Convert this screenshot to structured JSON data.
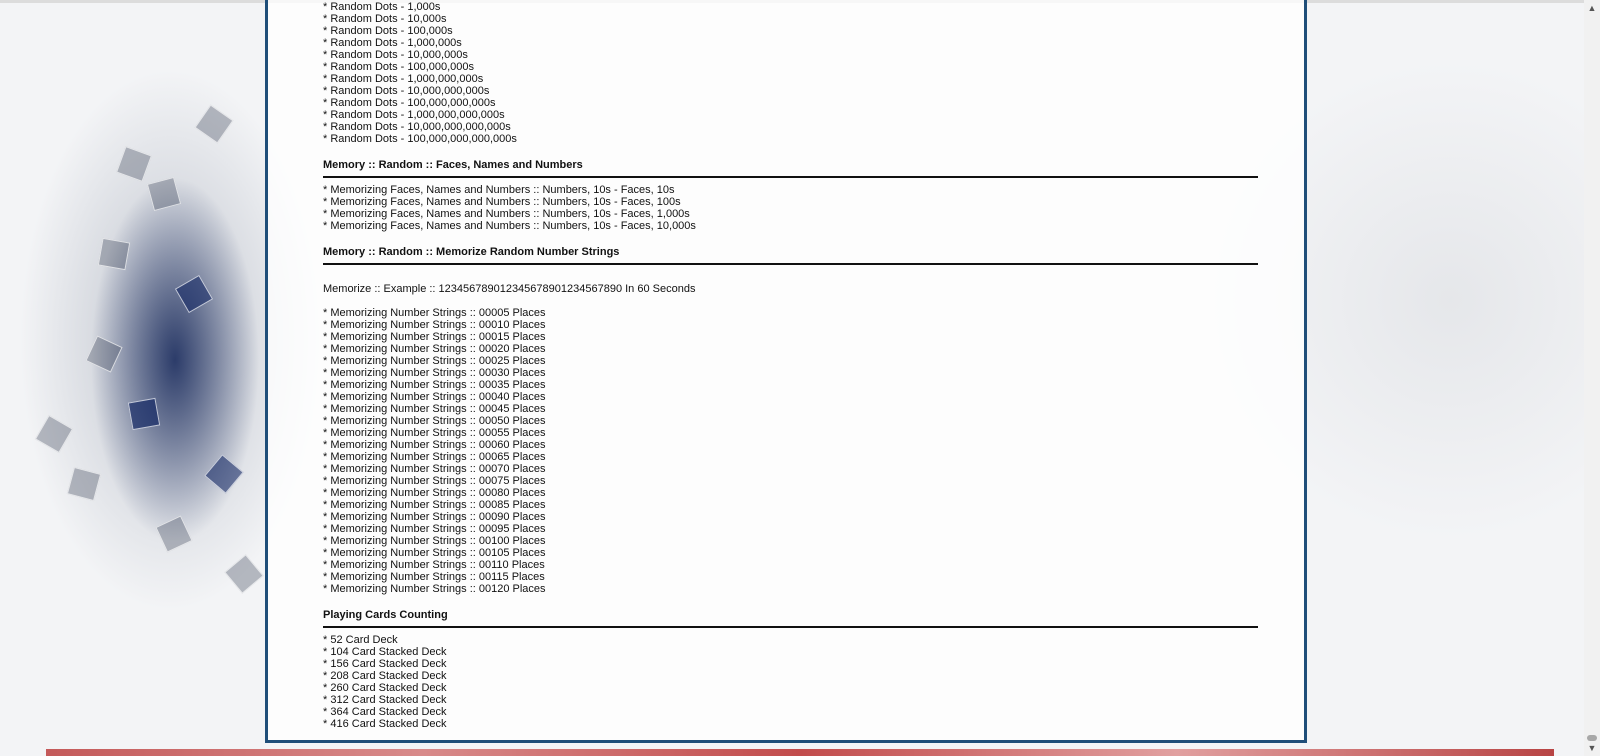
{
  "dots_list": [
    "* Random Dots - 1,000s",
    "* Random Dots - 10,000s",
    "* Random Dots - 100,000s",
    "* Random Dots - 1,000,000s",
    "* Random Dots - 10,000,000s",
    "* Random Dots - 100,000,000s",
    "* Random Dots - 1,000,000,000s",
    "* Random Dots - 10,000,000,000s",
    "* Random Dots - 100,000,000,000s",
    "* Random Dots - 1,000,000,000,000s",
    "* Random Dots - 10,000,000,000,000s",
    "* Random Dots - 100,000,000,000,000s"
  ],
  "faces_section": {
    "heading": "Memory :: Random :: Faces, Names and Numbers",
    "items": [
      "* Memorizing Faces, Names and Numbers :: Numbers, 10s - Faces, 10s",
      "* Memorizing Faces, Names and Numbers :: Numbers, 10s - Faces, 100s",
      "* Memorizing Faces, Names and Numbers :: Numbers, 10s - Faces, 1,000s",
      "* Memorizing Faces, Names and Numbers :: Numbers, 10s - Faces, 10,000s"
    ]
  },
  "strings_section": {
    "heading": "Memory :: Random :: Memorize Random Number Strings",
    "example": "Memorize :: Example :: 123456789012345678901234567890 In 60 Seconds",
    "items": [
      "* Memorizing Number Strings :: 00005 Places",
      "* Memorizing Number Strings :: 00010 Places",
      "* Memorizing Number Strings :: 00015 Places",
      "* Memorizing Number Strings :: 00020 Places",
      "* Memorizing Number Strings :: 00025 Places",
      "* Memorizing Number Strings :: 00030 Places",
      "* Memorizing Number Strings :: 00035 Places",
      "* Memorizing Number Strings :: 00040 Places",
      "* Memorizing Number Strings :: 00045 Places",
      "* Memorizing Number Strings :: 00050 Places",
      "* Memorizing Number Strings :: 00055 Places",
      "* Memorizing Number Strings :: 00060 Places",
      "* Memorizing Number Strings :: 00065 Places",
      "* Memorizing Number Strings :: 00070 Places",
      "* Memorizing Number Strings :: 00075 Places",
      "* Memorizing Number Strings :: 00080 Places",
      "* Memorizing Number Strings :: 00085 Places",
      "* Memorizing Number Strings :: 00090 Places",
      "* Memorizing Number Strings :: 00095 Places",
      "* Memorizing Number Strings :: 00100 Places",
      "* Memorizing Number Strings :: 00105 Places",
      "* Memorizing Number Strings :: 00110 Places",
      "* Memorizing Number Strings :: 00115 Places",
      "* Memorizing Number Strings :: 00120 Places"
    ]
  },
  "cards_section": {
    "heading": "Playing Cards Counting",
    "items": [
      "* 52 Card Deck",
      "* 104 Card Stacked Deck",
      "* 156 Card Stacked Deck",
      "* 208 Card Stacked Deck",
      "* 260 Card Stacked Deck",
      "* 312 Card Stacked Deck",
      "* 364 Card Stacked Deck",
      "* 416 Card Stacked Deck"
    ]
  },
  "colors": {
    "panel_border": "#1f4e79",
    "text": "#111111"
  },
  "icons": {
    "scroll_up": "scroll-up-arrow-icon",
    "scroll_down": "scroll-down-arrow-icon"
  }
}
